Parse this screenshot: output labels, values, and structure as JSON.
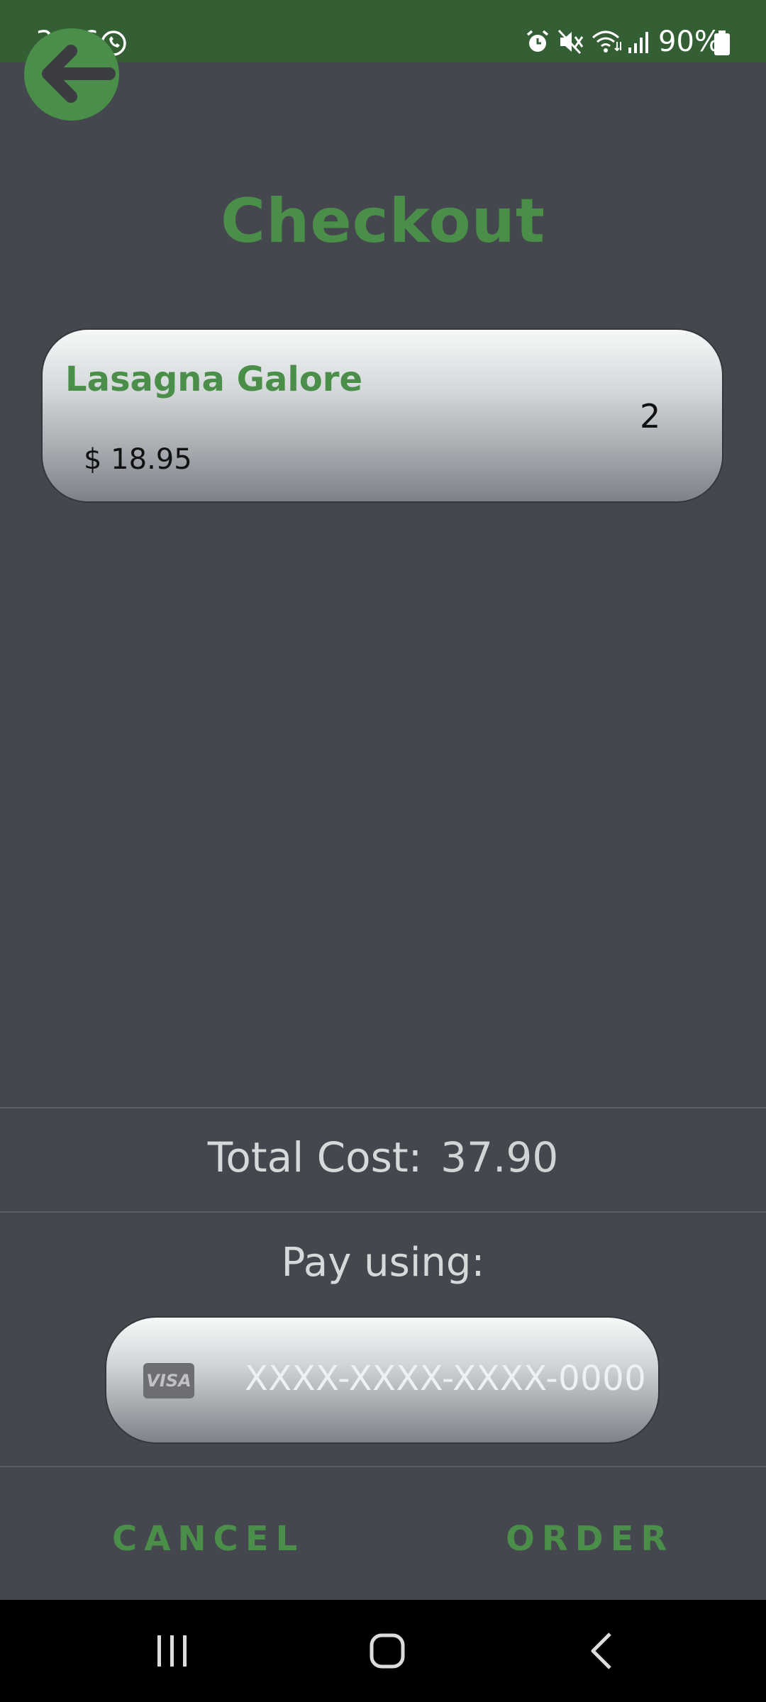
{
  "status_bar": {
    "time": "3:06",
    "battery": "90%",
    "icons": [
      "whatsapp-icon",
      "alarm-icon",
      "mute-icon",
      "wifi-icon",
      "signal-icon",
      "battery-icon"
    ]
  },
  "header": {
    "back_icon": "back-arrow-icon",
    "title": "Checkout"
  },
  "cart": {
    "items": [
      {
        "name": "Lasagna Galore",
        "price": "$ 18.95",
        "quantity": "2"
      }
    ]
  },
  "summary": {
    "total_label": "Total Cost:",
    "total_value": "37.90"
  },
  "payment": {
    "label": "Pay using:",
    "card_brand": "VISA",
    "card_number_placeholder": "XXXX-XXXX-XXXX-0000"
  },
  "actions": {
    "cancel_label": "CANCEL",
    "order_label": "ORDER"
  },
  "navigation": {
    "buttons": [
      "recents-icon",
      "home-icon",
      "back-icon"
    ]
  },
  "colors": {
    "accent": "#4a8e49",
    "status_bar": "#345f35",
    "background": "#45474e"
  }
}
